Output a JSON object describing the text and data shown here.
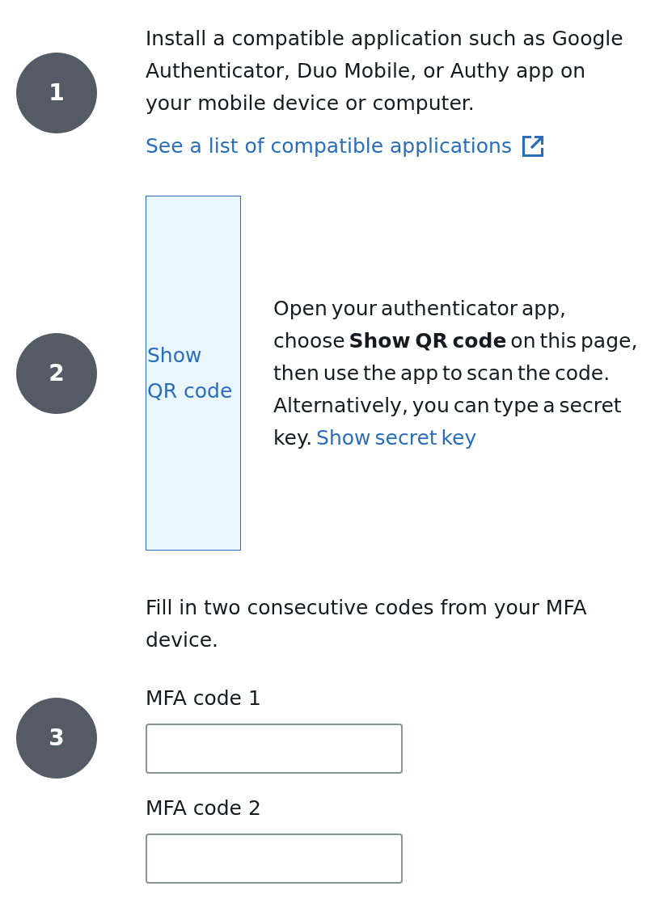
{
  "steps": [
    {
      "number": "1",
      "kind": "install",
      "text": "Install a compatible application such as Google Authenticator, Duo Mobile, or Authy app on your mobile device or computer.",
      "link": {
        "label": "See a list of compatible applications"
      }
    },
    {
      "number": "2",
      "kind": "scan",
      "qr_button": {
        "label": "Show QR code"
      },
      "text": "Open your authenticator app, choose **Show QR code** on this page, then use the app to scan the code. Alternatively, you can type a secret key.",
      "link": {
        "label": "Show secret key"
      }
    },
    {
      "number": "3",
      "kind": "codes",
      "text": "Fill in two consecutive codes from your MFA device.",
      "fields": [
        {
          "label": "MFA code 1"
        },
        {
          "label": "MFA code 2"
        }
      ]
    }
  ]
}
